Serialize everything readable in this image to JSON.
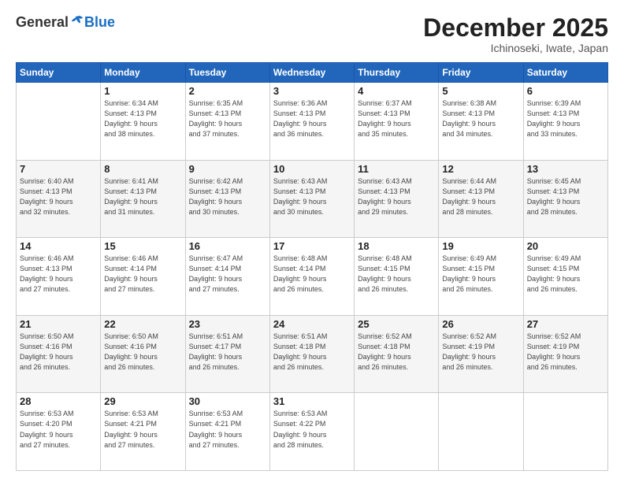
{
  "header": {
    "logo_general": "General",
    "logo_blue": "Blue",
    "title": "December 2025",
    "subtitle": "Ichinoseki, Iwate, Japan"
  },
  "days_of_week": [
    "Sunday",
    "Monday",
    "Tuesday",
    "Wednesday",
    "Thursday",
    "Friday",
    "Saturday"
  ],
  "weeks": [
    [
      {
        "day": "",
        "info": ""
      },
      {
        "day": "1",
        "info": "Sunrise: 6:34 AM\nSunset: 4:13 PM\nDaylight: 9 hours\nand 38 minutes."
      },
      {
        "day": "2",
        "info": "Sunrise: 6:35 AM\nSunset: 4:13 PM\nDaylight: 9 hours\nand 37 minutes."
      },
      {
        "day": "3",
        "info": "Sunrise: 6:36 AM\nSunset: 4:13 PM\nDaylight: 9 hours\nand 36 minutes."
      },
      {
        "day": "4",
        "info": "Sunrise: 6:37 AM\nSunset: 4:13 PM\nDaylight: 9 hours\nand 35 minutes."
      },
      {
        "day": "5",
        "info": "Sunrise: 6:38 AM\nSunset: 4:13 PM\nDaylight: 9 hours\nand 34 minutes."
      },
      {
        "day": "6",
        "info": "Sunrise: 6:39 AM\nSunset: 4:13 PM\nDaylight: 9 hours\nand 33 minutes."
      }
    ],
    [
      {
        "day": "7",
        "info": "Sunrise: 6:40 AM\nSunset: 4:13 PM\nDaylight: 9 hours\nand 32 minutes."
      },
      {
        "day": "8",
        "info": "Sunrise: 6:41 AM\nSunset: 4:13 PM\nDaylight: 9 hours\nand 31 minutes."
      },
      {
        "day": "9",
        "info": "Sunrise: 6:42 AM\nSunset: 4:13 PM\nDaylight: 9 hours\nand 30 minutes."
      },
      {
        "day": "10",
        "info": "Sunrise: 6:43 AM\nSunset: 4:13 PM\nDaylight: 9 hours\nand 30 minutes."
      },
      {
        "day": "11",
        "info": "Sunrise: 6:43 AM\nSunset: 4:13 PM\nDaylight: 9 hours\nand 29 minutes."
      },
      {
        "day": "12",
        "info": "Sunrise: 6:44 AM\nSunset: 4:13 PM\nDaylight: 9 hours\nand 28 minutes."
      },
      {
        "day": "13",
        "info": "Sunrise: 6:45 AM\nSunset: 4:13 PM\nDaylight: 9 hours\nand 28 minutes."
      }
    ],
    [
      {
        "day": "14",
        "info": "Sunrise: 6:46 AM\nSunset: 4:13 PM\nDaylight: 9 hours\nand 27 minutes."
      },
      {
        "day": "15",
        "info": "Sunrise: 6:46 AM\nSunset: 4:14 PM\nDaylight: 9 hours\nand 27 minutes."
      },
      {
        "day": "16",
        "info": "Sunrise: 6:47 AM\nSunset: 4:14 PM\nDaylight: 9 hours\nand 27 minutes."
      },
      {
        "day": "17",
        "info": "Sunrise: 6:48 AM\nSunset: 4:14 PM\nDaylight: 9 hours\nand 26 minutes."
      },
      {
        "day": "18",
        "info": "Sunrise: 6:48 AM\nSunset: 4:15 PM\nDaylight: 9 hours\nand 26 minutes."
      },
      {
        "day": "19",
        "info": "Sunrise: 6:49 AM\nSunset: 4:15 PM\nDaylight: 9 hours\nand 26 minutes."
      },
      {
        "day": "20",
        "info": "Sunrise: 6:49 AM\nSunset: 4:15 PM\nDaylight: 9 hours\nand 26 minutes."
      }
    ],
    [
      {
        "day": "21",
        "info": "Sunrise: 6:50 AM\nSunset: 4:16 PM\nDaylight: 9 hours\nand 26 minutes."
      },
      {
        "day": "22",
        "info": "Sunrise: 6:50 AM\nSunset: 4:16 PM\nDaylight: 9 hours\nand 26 minutes."
      },
      {
        "day": "23",
        "info": "Sunrise: 6:51 AM\nSunset: 4:17 PM\nDaylight: 9 hours\nand 26 minutes."
      },
      {
        "day": "24",
        "info": "Sunrise: 6:51 AM\nSunset: 4:18 PM\nDaylight: 9 hours\nand 26 minutes."
      },
      {
        "day": "25",
        "info": "Sunrise: 6:52 AM\nSunset: 4:18 PM\nDaylight: 9 hours\nand 26 minutes."
      },
      {
        "day": "26",
        "info": "Sunrise: 6:52 AM\nSunset: 4:19 PM\nDaylight: 9 hours\nand 26 minutes."
      },
      {
        "day": "27",
        "info": "Sunrise: 6:52 AM\nSunset: 4:19 PM\nDaylight: 9 hours\nand 26 minutes."
      }
    ],
    [
      {
        "day": "28",
        "info": "Sunrise: 6:53 AM\nSunset: 4:20 PM\nDaylight: 9 hours\nand 27 minutes."
      },
      {
        "day": "29",
        "info": "Sunrise: 6:53 AM\nSunset: 4:21 PM\nDaylight: 9 hours\nand 27 minutes."
      },
      {
        "day": "30",
        "info": "Sunrise: 6:53 AM\nSunset: 4:21 PM\nDaylight: 9 hours\nand 27 minutes."
      },
      {
        "day": "31",
        "info": "Sunrise: 6:53 AM\nSunset: 4:22 PM\nDaylight: 9 hours\nand 28 minutes."
      },
      {
        "day": "",
        "info": ""
      },
      {
        "day": "",
        "info": ""
      },
      {
        "day": "",
        "info": ""
      }
    ]
  ]
}
